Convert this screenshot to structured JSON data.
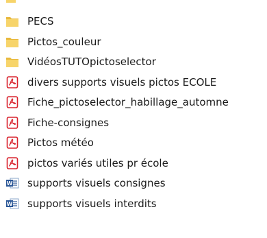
{
  "explorer": {
    "files": [
      {
        "name": "PECS",
        "icon": "folder-icon"
      },
      {
        "name": "Pictos_couleur",
        "icon": "folder-icon"
      },
      {
        "name": "VidéosTUTOpictoselector",
        "icon": "folder-icon"
      },
      {
        "name": "divers supports visuels pictos ECOLE",
        "icon": "pdf-icon"
      },
      {
        "name": "Fiche_pictoselector_habillage_automne",
        "icon": "pdf-icon"
      },
      {
        "name": "Fiche-consignes",
        "icon": "pdf-icon"
      },
      {
        "name": "Pictos météo",
        "icon": "pdf-icon"
      },
      {
        "name": "pictos variés utiles pr école",
        "icon": "pdf-icon"
      },
      {
        "name": "supports visuels consignes",
        "icon": "word-doc-icon"
      },
      {
        "name": "supports visuels interdits",
        "icon": "word-doc-icon"
      }
    ]
  },
  "colors": {
    "folder": "#f7d46a",
    "folder_shade": "#e8b83b",
    "pdf": "#d9232e",
    "word": "#2b5797"
  }
}
